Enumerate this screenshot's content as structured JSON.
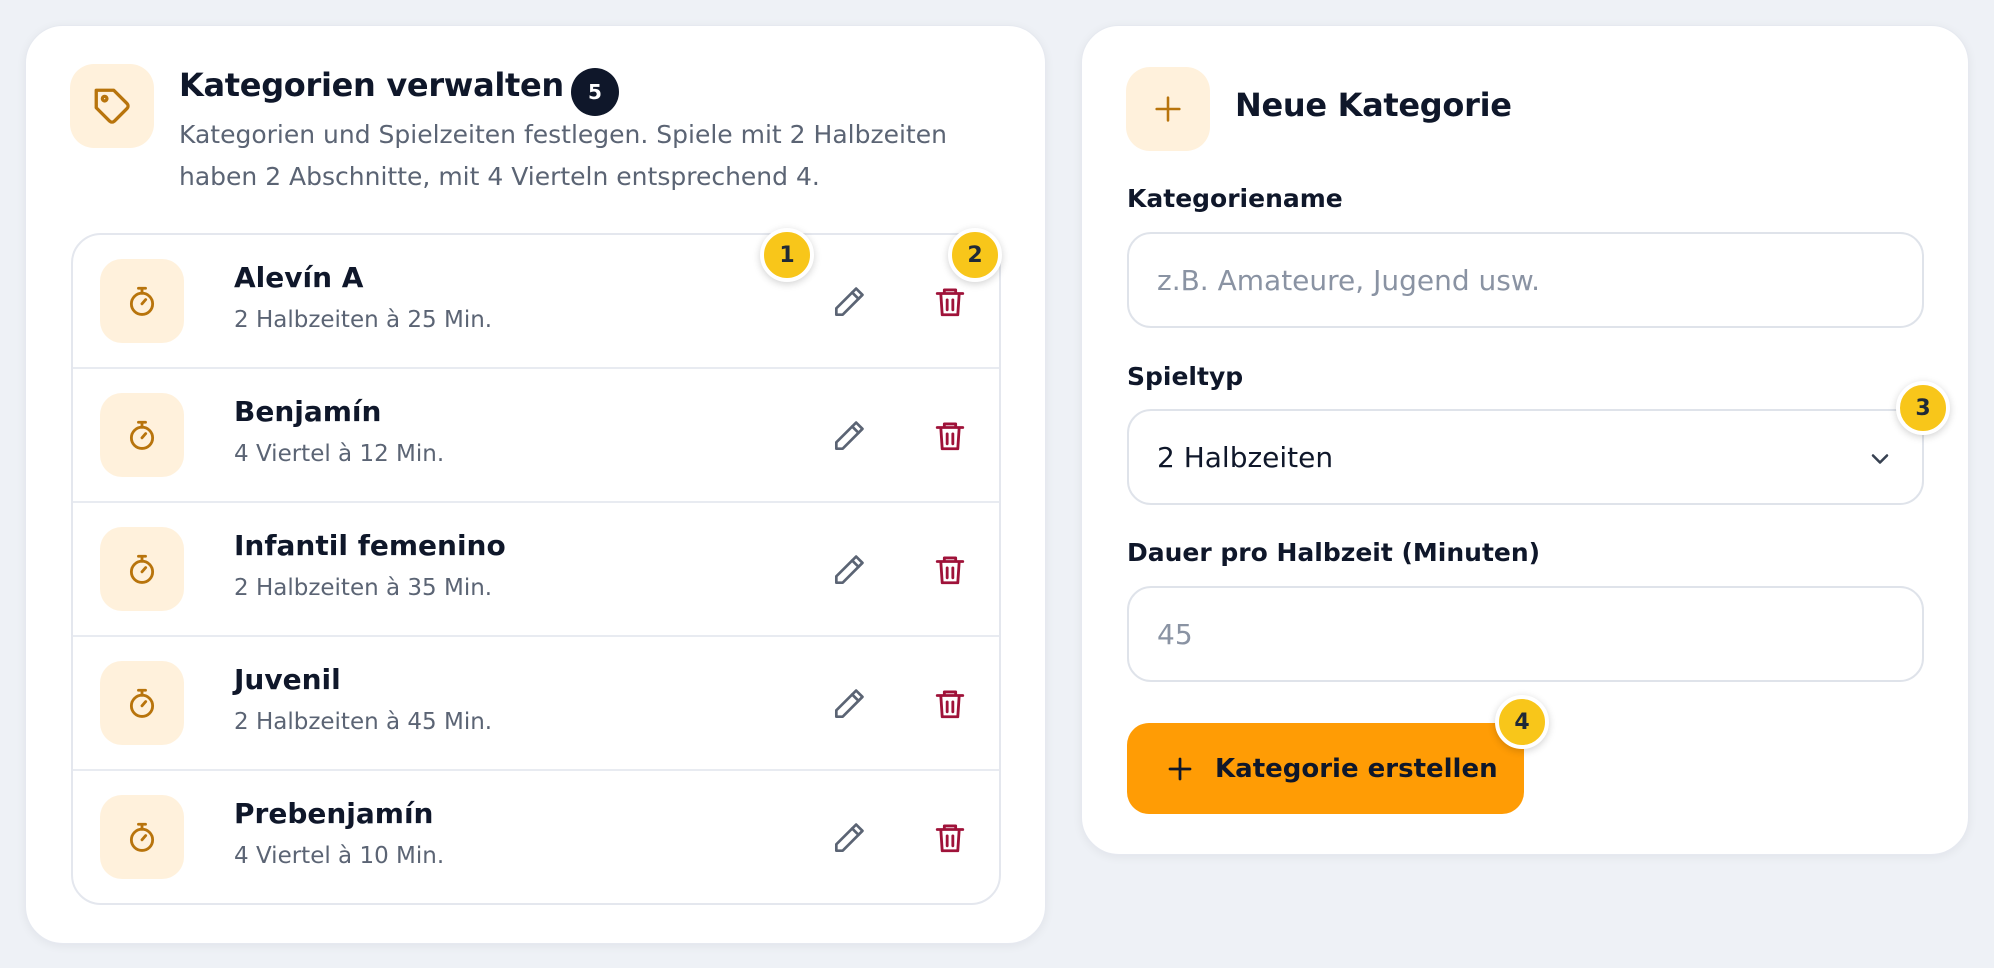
{
  "manage": {
    "title": "Kategorien verwalten",
    "count": "5",
    "description": "Kategorien und Spielzeiten festlegen. Spiele mit 2 Halbzeiten haben 2 Abschnitte, mit 4 Vierteln entsprechend 4.",
    "icon": "tag-icon",
    "categories": [
      {
        "name": "Alevín A",
        "detail": "2 Halbzeiten à 25 Min."
      },
      {
        "name": "Benjamín",
        "detail": "4 Viertel à 12 Min."
      },
      {
        "name": "Infantil femenino",
        "detail": "2 Halbzeiten à 35 Min."
      },
      {
        "name": "Juvenil",
        "detail": "2 Halbzeiten à 45 Min."
      },
      {
        "name": "Prebenjamín",
        "detail": "4 Viertel à 10 Min."
      }
    ]
  },
  "create": {
    "title": "Neue Kategorie",
    "name_label": "Kategoriename",
    "name_placeholder": "z.B. Amateure, Jugend usw.",
    "type_label": "Spieltyp",
    "type_value": "2 Halbzeiten",
    "duration_label": "Dauer pro Halbzeit (Minuten)",
    "duration_placeholder": "45",
    "submit_label": "Kategorie erstellen"
  },
  "markers": [
    "1",
    "2",
    "3",
    "4"
  ],
  "colors": {
    "accent": "#ff9c05",
    "icon_bg": "#fff1dc",
    "icon_stroke": "#b8740c",
    "delete": "#9f1239",
    "marker": "#f8c61a",
    "badge": "#0f172a"
  }
}
